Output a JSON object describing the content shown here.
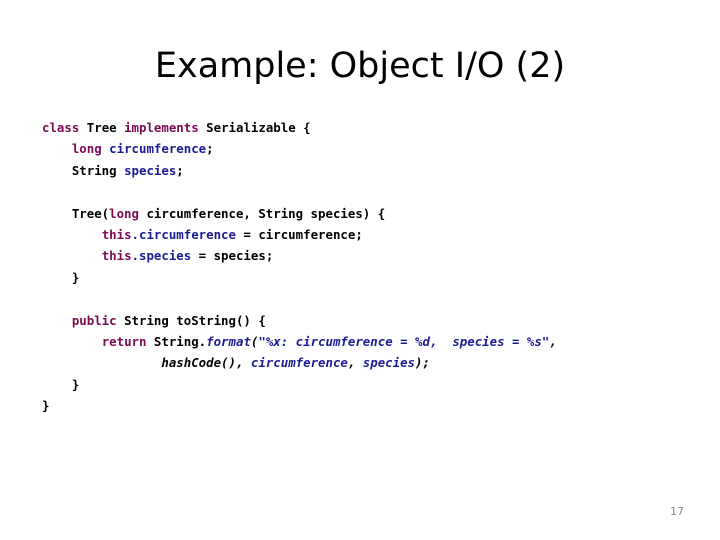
{
  "slide": {
    "title": "Example: Object I/O (2)",
    "page_number": "17",
    "background_color": "#ffffff"
  },
  "colors": {
    "keyword": "#7c0a51",
    "identifier": "#1b1b96",
    "plain": "#000000",
    "string": "#1b1b96",
    "page_number": "#8c8c8c"
  },
  "code": {
    "language": "Java",
    "full_text": "class Tree implements Serializable {\n    long circumference;\n    String species;\n\n    Tree(long circumference, String species) {\n        this.circumference = circumference;\n        this.species = species;\n    }\n\n    public String toString() {\n        return String.format(\"%x: circumference = %d,  species = %s\",\n                hashCode(), circumference, species);\n    }\n}",
    "lines": [
      {
        "id": "line-1",
        "tokens": [
          {
            "text": "class",
            "style": "kw"
          },
          {
            "text": " ",
            "style": "plain"
          },
          {
            "text": "Tree",
            "style": "plain"
          },
          {
            "text": " ",
            "style": "plain"
          },
          {
            "text": "implements",
            "style": "kw"
          },
          {
            "text": " ",
            "style": "plain"
          },
          {
            "text": "Serializable {",
            "style": "plain"
          }
        ]
      },
      {
        "id": "line-2",
        "tokens": [
          {
            "text": "    ",
            "style": "plain"
          },
          {
            "text": "long",
            "style": "kw"
          },
          {
            "text": " ",
            "style": "plain"
          },
          {
            "text": "circumference",
            "style": "ident"
          },
          {
            "text": ";",
            "style": "plain"
          }
        ]
      },
      {
        "id": "line-3",
        "tokens": [
          {
            "text": "    ",
            "style": "plain"
          },
          {
            "text": "String",
            "style": "plain"
          },
          {
            "text": " ",
            "style": "plain"
          },
          {
            "text": "species",
            "style": "ident"
          },
          {
            "text": ";",
            "style": "plain"
          }
        ]
      },
      {
        "id": "line-4",
        "tokens": []
      },
      {
        "id": "line-5",
        "tokens": [
          {
            "text": "    Tree(",
            "style": "plain"
          },
          {
            "text": "long",
            "style": "kw"
          },
          {
            "text": " circumference, String species) {",
            "style": "plain"
          }
        ]
      },
      {
        "id": "line-6",
        "tokens": [
          {
            "text": "        ",
            "style": "plain"
          },
          {
            "text": "this",
            "style": "kw"
          },
          {
            "text": ".circumference",
            "style": "ident"
          },
          {
            "text": " = circumference;",
            "style": "plain"
          }
        ]
      },
      {
        "id": "line-7",
        "tokens": [
          {
            "text": "        ",
            "style": "plain"
          },
          {
            "text": "this",
            "style": "kw"
          },
          {
            "text": ".species",
            "style": "ident"
          },
          {
            "text": " = species;",
            "style": "plain"
          }
        ]
      },
      {
        "id": "line-8",
        "tokens": [
          {
            "text": "    }",
            "style": "plain"
          }
        ]
      },
      {
        "id": "line-9",
        "tokens": []
      },
      {
        "id": "line-10",
        "tokens": [
          {
            "text": "    ",
            "style": "plain"
          },
          {
            "text": "public",
            "style": "kw"
          },
          {
            "text": " String toString() {",
            "style": "plain"
          }
        ]
      },
      {
        "id": "line-11",
        "tokens": [
          {
            "text": "        ",
            "style": "plain"
          },
          {
            "text": "return",
            "style": "kw"
          },
          {
            "text": " String.",
            "style": "plain"
          },
          {
            "text": "format",
            "style": "ident-it"
          },
          {
            "text": "(",
            "style": "plain-it"
          },
          {
            "text": "\"%x: circumference = %d,  species = %s\"",
            "style": "str"
          },
          {
            "text": ",",
            "style": "plain-it"
          }
        ]
      },
      {
        "id": "line-12",
        "tokens": [
          {
            "text": "                ",
            "style": "plain"
          },
          {
            "text": "hashCode()",
            "style": "plain-it"
          },
          {
            "text": ", ",
            "style": "plain-it"
          },
          {
            "text": "circumference",
            "style": "ident-it"
          },
          {
            "text": ", ",
            "style": "plain-it"
          },
          {
            "text": "species",
            "style": "ident-it"
          },
          {
            "text": ");",
            "style": "plain-it"
          }
        ]
      },
      {
        "id": "line-13",
        "tokens": [
          {
            "text": "    }",
            "style": "plain"
          }
        ]
      },
      {
        "id": "line-14",
        "tokens": [
          {
            "text": "}",
            "style": "plain"
          }
        ]
      }
    ]
  }
}
